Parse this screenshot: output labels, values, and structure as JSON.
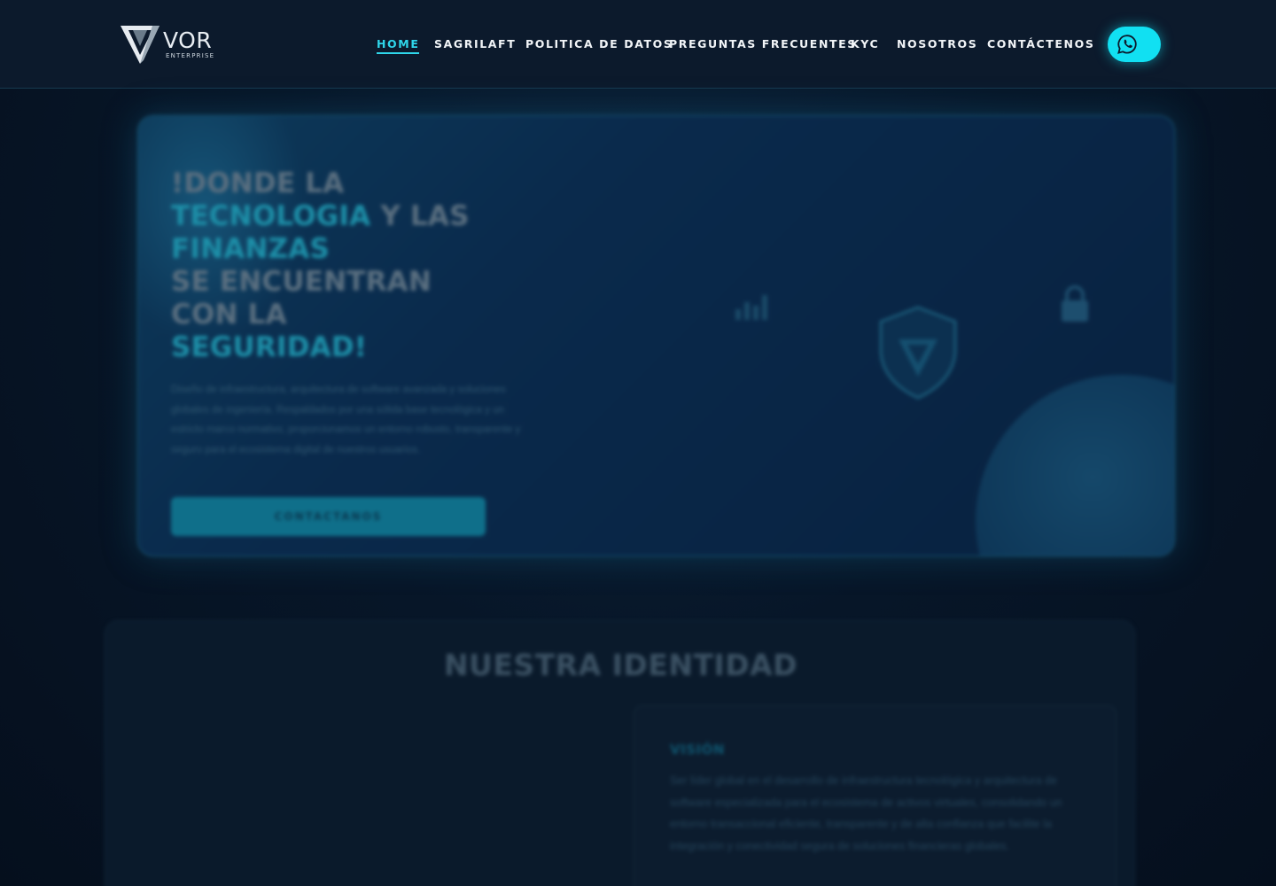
{
  "brand": {
    "name": "VOR",
    "sub": "ENTERPRISE"
  },
  "nav": {
    "items": [
      {
        "label": "HOME",
        "active": true
      },
      {
        "label": "SAGRILAFT",
        "active": false
      },
      {
        "label": "POLITICA DE DATOS",
        "active": false
      },
      {
        "label": "PREGUNTAS FRECUENTES",
        "active": false
      },
      {
        "label": "KYC",
        "active": false
      },
      {
        "label": "NOSOTROS",
        "active": false
      },
      {
        "label": "CONTÁCTENOS",
        "active": false
      }
    ],
    "whatsapp_icon": "whatsapp-icon"
  },
  "hero": {
    "line1": "!DONDE LA",
    "line2_accent": "TECNOLOGIA",
    "line2_rest": " Y LAS",
    "line3_accent": "FINANZAS",
    "line4": "SE ENCUENTRAN",
    "line5": "CON LA",
    "line6_accent": "SEGURIDAD!",
    "description": "Diseño de infraestructura, arquitectura de software avanzada y soluciones globales de ingeniería. Respaldados por una sólida base tecnológica y un estricto marco normativo, proporcionamos un entorno robusto, transparente y seguro para el ecosistema digital de nuestros usuarios.",
    "cta": "CONTACTANOS"
  },
  "identity": {
    "title": "NUESTRA IDENTIDAD",
    "vision_title": "VISIÓN",
    "vision_text": "Ser líder global en el desarrollo de infraestructura tecnológica y arquitectura de software especializada para el ecosistema de activos virtuales, consolidando un entorno transaccional eficiente, transparente y de alta confianza que facilite la integración y conectividad segura de soluciones financieras globales."
  },
  "colors": {
    "accent": "#2fd6ea",
    "whatsapp_button": "#11e0f2",
    "navbar": "#0c1a2c"
  }
}
